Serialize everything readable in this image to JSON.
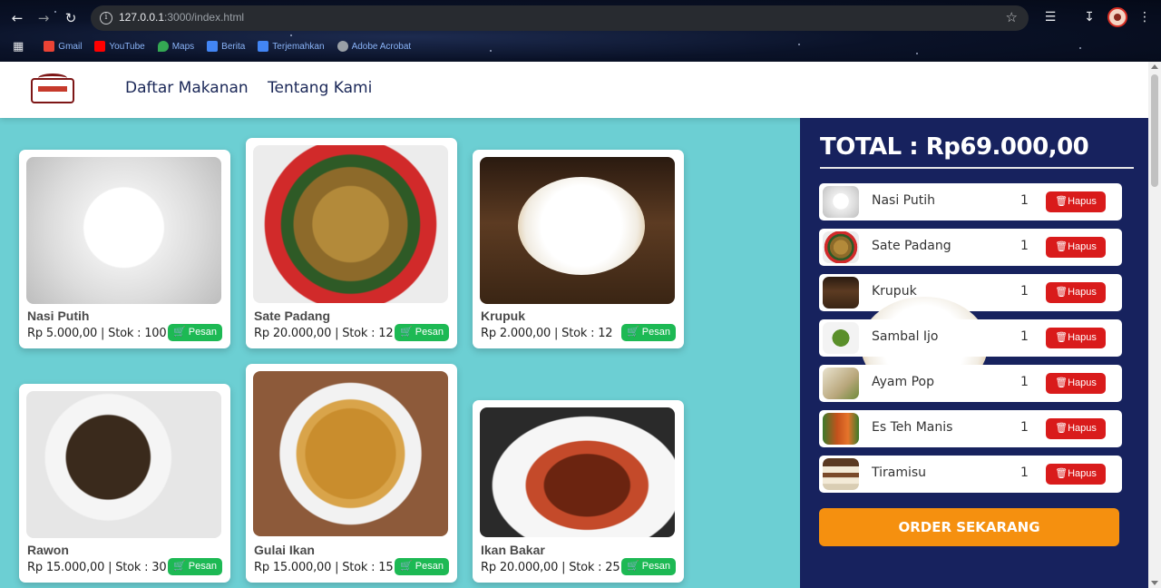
{
  "browser": {
    "url_host": "127.0.0.1",
    "url_rest": ":3000/index.html",
    "bookmarks": [
      {
        "label": "Gmail",
        "icon": "gmail-icon",
        "color": "#ea4335"
      },
      {
        "label": "YouTube",
        "icon": "youtube-icon",
        "color": "#ff0000"
      },
      {
        "label": "Maps",
        "icon": "maps-icon",
        "color": "#34a853"
      },
      {
        "label": "Berita",
        "icon": "news-icon",
        "color": "#4285f4"
      },
      {
        "label": "Terjemahkan",
        "icon": "translate-icon",
        "color": "#4285f4"
      },
      {
        "label": "Adobe Acrobat",
        "icon": "acrobat-icon",
        "color": "#9aa0a6"
      }
    ]
  },
  "header": {
    "nav": [
      "Daftar Makanan",
      "Tentang Kami"
    ]
  },
  "products": [
    {
      "name": "Nasi Putih",
      "price": "Rp 5.000,00 | Stok : 100",
      "button": "Pesan"
    },
    {
      "name": "Sate Padang",
      "price": "Rp 20.000,00 | Stok : 12",
      "button": "Pesan"
    },
    {
      "name": "Krupuk",
      "price": "Rp 2.000,00 | Stok : 12",
      "button": "Pesan"
    },
    {
      "name": "Rawon",
      "price": "Rp 15.000,00 | Stok : 30",
      "button": "Pesan"
    },
    {
      "name": "Gulai Ikan",
      "price": "Rp 15.000,00 | Stok : 15",
      "button": "Pesan"
    },
    {
      "name": "Ikan Bakar",
      "price": "Rp 20.000,00 | Stok : 25",
      "button": "Pesan"
    }
  ],
  "cart": {
    "total": "TOTAL : Rp69.000,00",
    "items": [
      {
        "name": "Nasi Putih",
        "qty": "1",
        "delete": "Hapus"
      },
      {
        "name": "Sate Padang",
        "qty": "1",
        "delete": "Hapus"
      },
      {
        "name": "Krupuk",
        "qty": "1",
        "delete": "Hapus"
      },
      {
        "name": "Sambal Ijo",
        "qty": "1",
        "delete": "Hapus"
      },
      {
        "name": "Ayam Pop",
        "qty": "1",
        "delete": "Hapus"
      },
      {
        "name": "Es Teh Manis",
        "qty": "1",
        "delete": "Hapus"
      },
      {
        "name": "Tiramisu",
        "qty": "1",
        "delete": "Hapus"
      }
    ],
    "order_button": "ORDER SEKARANG"
  },
  "colors": {
    "accent_green": "#1db954",
    "delete_red": "#d91b1b",
    "order_orange": "#f5900f",
    "cart_bg": "#17225e",
    "page_bg": "#6ccfd3"
  }
}
